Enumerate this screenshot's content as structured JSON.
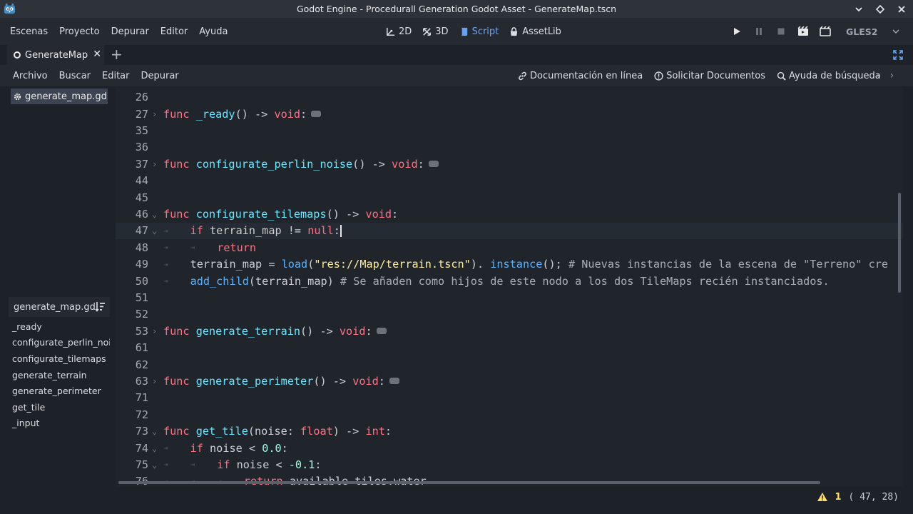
{
  "window": {
    "title": "Godot Engine - Procedurall Generation Godot Asset - GenerateMap.tscn"
  },
  "main_menu": [
    "Escenas",
    "Proyecto",
    "Depurar",
    "Editor",
    "Ayuda"
  ],
  "modes": [
    {
      "label": "2D",
      "icon": "2d-icon",
      "active": false
    },
    {
      "label": "3D",
      "icon": "3d-icon",
      "active": false
    },
    {
      "label": "Script",
      "icon": "script-icon",
      "active": true
    },
    {
      "label": "AssetLib",
      "icon": "assetlib-icon",
      "active": false
    }
  ],
  "renderer": "GLES2",
  "scene_tabs": [
    {
      "label": "GenerateMap"
    }
  ],
  "script_menu": [
    "Archivo",
    "Buscar",
    "Editar",
    "Depurar"
  ],
  "help_links": [
    {
      "label": "Documentación en línea",
      "icon": "link-icon"
    },
    {
      "label": "Solicitar Documentos",
      "icon": "info-icon"
    },
    {
      "label": "Ayuda de búsqueda",
      "icon": "help-search-icon"
    }
  ],
  "open_scripts": [
    {
      "label": "generate_map.gd"
    }
  ],
  "outline": {
    "title": "generate_map.gd",
    "functions": [
      "_ready",
      "configurate_perlin_noise",
      "configurate_tilemaps",
      "generate_terrain",
      "generate_perimeter",
      "get_tile",
      "_input"
    ]
  },
  "code": {
    "lines": [
      {
        "n": "26",
        "fold": "",
        "tabs": 0,
        "tokens": []
      },
      {
        "n": "27",
        "fold": "›",
        "tabs": 0,
        "folded": true,
        "tokens": [
          [
            "kw",
            "func "
          ],
          [
            "fname",
            "_ready"
          ],
          [
            "",
            "() -> "
          ],
          [
            "kw",
            "void"
          ],
          [
            "",
            ":"
          ]
        ]
      },
      {
        "n": "35",
        "fold": "",
        "tabs": 0,
        "tokens": []
      },
      {
        "n": "36",
        "fold": "",
        "tabs": 0,
        "tokens": []
      },
      {
        "n": "37",
        "fold": "›",
        "tabs": 0,
        "folded": true,
        "tokens": [
          [
            "kw",
            "func "
          ],
          [
            "fname",
            "configurate_perlin_noise"
          ],
          [
            "",
            "() -> "
          ],
          [
            "kw",
            "void"
          ],
          [
            "",
            ":"
          ]
        ]
      },
      {
        "n": "44",
        "fold": "",
        "tabs": 0,
        "tokens": []
      },
      {
        "n": "45",
        "fold": "",
        "tabs": 0,
        "tokens": []
      },
      {
        "n": "46",
        "fold": "⌄",
        "tabs": 0,
        "tokens": [
          [
            "kw",
            "func "
          ],
          [
            "fname",
            "configurate_tilemaps"
          ],
          [
            "",
            "() -> "
          ],
          [
            "kw",
            "void"
          ],
          [
            "",
            ":"
          ]
        ]
      },
      {
        "n": "47",
        "fold": "⌄",
        "tabs": 1,
        "current": true,
        "caret": true,
        "tokens": [
          [
            "kw",
            "if "
          ],
          [
            "",
            "terrain_map != "
          ],
          [
            "kw",
            "null"
          ],
          [
            "",
            ":"
          ]
        ]
      },
      {
        "n": "48",
        "fold": "",
        "tabs": 2,
        "tokens": [
          [
            "kw",
            "return"
          ]
        ]
      },
      {
        "n": "49",
        "fold": "",
        "tabs": 1,
        "tokens": [
          [
            "",
            "terrain_map = "
          ],
          [
            "mfn",
            "load"
          ],
          [
            "",
            "("
          ],
          [
            "str",
            "\"res://Map/terrain.tscn\""
          ],
          [
            "",
            "). "
          ],
          [
            "mfn",
            "instance"
          ],
          [
            "",
            "(); "
          ],
          [
            "cmt",
            "# Nuevas instancias de la escena de \"Terreno\" cre"
          ]
        ]
      },
      {
        "n": "50",
        "fold": "",
        "tabs": 1,
        "tokens": [
          [
            "mfn",
            "add_child"
          ],
          [
            "",
            "(terrain_map) "
          ],
          [
            "cmt",
            "# Se añaden como hijos de este nodo a los dos TileMaps recién instanciados."
          ]
        ]
      },
      {
        "n": "51",
        "fold": "",
        "tabs": 0,
        "tokens": []
      },
      {
        "n": "52",
        "fold": "",
        "tabs": 0,
        "tokens": []
      },
      {
        "n": "53",
        "fold": "›",
        "tabs": 0,
        "folded": true,
        "tokens": [
          [
            "kw",
            "func "
          ],
          [
            "fname",
            "generate_terrain"
          ],
          [
            "",
            "() -> "
          ],
          [
            "kw",
            "void"
          ],
          [
            "",
            ":"
          ]
        ]
      },
      {
        "n": "61",
        "fold": "",
        "tabs": 0,
        "tokens": []
      },
      {
        "n": "62",
        "fold": "",
        "tabs": 0,
        "tokens": []
      },
      {
        "n": "63",
        "fold": "›",
        "tabs": 0,
        "folded": true,
        "tokens": [
          [
            "kw",
            "func "
          ],
          [
            "fname",
            "generate_perimeter"
          ],
          [
            "",
            "() -> "
          ],
          [
            "kw",
            "void"
          ],
          [
            "",
            ":"
          ]
        ]
      },
      {
        "n": "71",
        "fold": "",
        "tabs": 0,
        "tokens": []
      },
      {
        "n": "72",
        "fold": "",
        "tabs": 0,
        "tokens": []
      },
      {
        "n": "73",
        "fold": "⌄",
        "tabs": 0,
        "tokens": [
          [
            "kw",
            "func "
          ],
          [
            "fname",
            "get_tile"
          ],
          [
            "",
            "(noise: "
          ],
          [
            "typ",
            "float"
          ],
          [
            "",
            ") -> "
          ],
          [
            "kw",
            "int"
          ],
          [
            "",
            ":"
          ]
        ]
      },
      {
        "n": "74",
        "fold": "⌄",
        "tabs": 1,
        "tokens": [
          [
            "kw",
            "if "
          ],
          [
            "",
            "noise < "
          ],
          [
            "num",
            "0.0"
          ],
          [
            "",
            ":"
          ]
        ]
      },
      {
        "n": "75",
        "fold": "⌄",
        "tabs": 2,
        "tokens": [
          [
            "kw",
            "if "
          ],
          [
            "",
            "noise < "
          ],
          [
            "num",
            "-0.1"
          ],
          [
            "",
            ":"
          ]
        ]
      },
      {
        "n": "76",
        "fold": "",
        "tabs": 3,
        "tokens": [
          [
            "kw",
            "return "
          ],
          [
            "",
            "available_tiles.water"
          ]
        ]
      }
    ]
  },
  "status": {
    "warnings": "1",
    "position": "( 47, 28)"
  },
  "colors": {
    "keyword": "#ff7085",
    "function_name": "#66e6ff",
    "member_function": "#57b3ff",
    "string": "#ffeda1",
    "number": "#a1ffe0",
    "accent": "#69a2f0",
    "warning": "#ffdd65"
  }
}
